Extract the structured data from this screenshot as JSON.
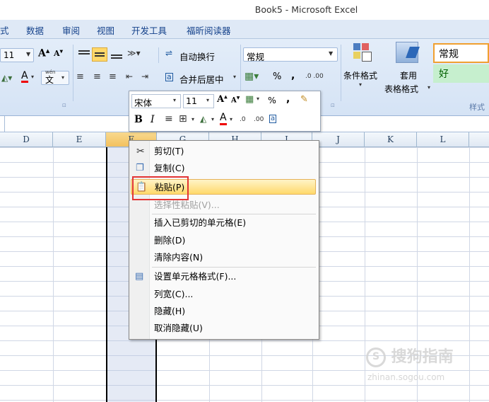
{
  "window": {
    "title": "Book5 - Microsoft Excel"
  },
  "ribbon": {
    "tabs": [
      "式",
      "数据",
      "审阅",
      "视图",
      "开发工具",
      "福昕阅读器"
    ],
    "font_size": "11",
    "wrap_text": "自动换行",
    "merge_center": "合并后居中",
    "number_format": "常规",
    "percent": "%",
    "comma": ",",
    "conditional_format": "条件格式",
    "table_format_line1": "套用",
    "table_format_line2": "表格格式",
    "style_normal": "常规",
    "style_good": "好",
    "styles_group": "样式",
    "phonetic": "wén"
  },
  "mini_toolbar": {
    "font_name": "宋体",
    "font_size": "11",
    "bold": "B",
    "italic": "I",
    "percent": "%",
    "comma": ","
  },
  "columns": [
    "D",
    "E",
    "F",
    "G",
    "H",
    "I",
    "J",
    "K",
    "L"
  ],
  "context_menu": {
    "items": [
      {
        "label": "剪切(T)",
        "enabled": true
      },
      {
        "label": "复制(C)",
        "enabled": true
      },
      {
        "label": "粘贴(P)",
        "enabled": true,
        "highlighted": true
      },
      {
        "label": "选择性粘贴(V)...",
        "enabled": false
      },
      {
        "label": "插入已剪切的单元格(E)",
        "enabled": true
      },
      {
        "label": "删除(D)",
        "enabled": true
      },
      {
        "label": "清除内容(N)",
        "enabled": true
      },
      {
        "label": "设置单元格格式(F)...",
        "enabled": true
      },
      {
        "label": "列宽(C)...",
        "enabled": true
      },
      {
        "label": "隐藏(H)",
        "enabled": true
      },
      {
        "label": "取消隐藏(U)",
        "enabled": true
      }
    ]
  },
  "watermark": {
    "text": "搜狗指南",
    "subtext": "zhinan.sogou.com"
  },
  "colors": {
    "ribbon": "#dfe9f6",
    "highlight": "#ffd96b",
    "annotation": "#e23535"
  }
}
